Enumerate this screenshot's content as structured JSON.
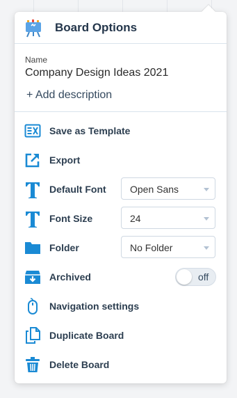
{
  "header": {
    "title": "Board Options",
    "icon": "board-easel-icon"
  },
  "board": {
    "name_label": "Name",
    "name_value": "Company Design Ideas 2021",
    "add_description": "+ Add description"
  },
  "menu": {
    "save_template": {
      "label": "Save as Template",
      "icon": "template-icon"
    },
    "export": {
      "label": "Export",
      "icon": "export-icon"
    },
    "default_font": {
      "label": "Default Font",
      "icon": "font-t-icon",
      "value": "Open Sans"
    },
    "font_size": {
      "label": "Font Size",
      "icon": "font-t-icon",
      "value": "24"
    },
    "folder": {
      "label": "Folder",
      "icon": "folder-icon",
      "value": "No Folder"
    },
    "archived": {
      "label": "Archived",
      "icon": "archive-box-icon",
      "state": "off"
    },
    "navigation": {
      "label": "Navigation settings",
      "icon": "mouse-icon"
    },
    "duplicate": {
      "label": "Duplicate Board",
      "icon": "duplicate-icon"
    },
    "delete": {
      "label": "Delete Board",
      "icon": "trash-icon"
    }
  },
  "colors": {
    "accent": "#1a8ad4",
    "title": "#24364b",
    "label": "#2c3e50"
  }
}
